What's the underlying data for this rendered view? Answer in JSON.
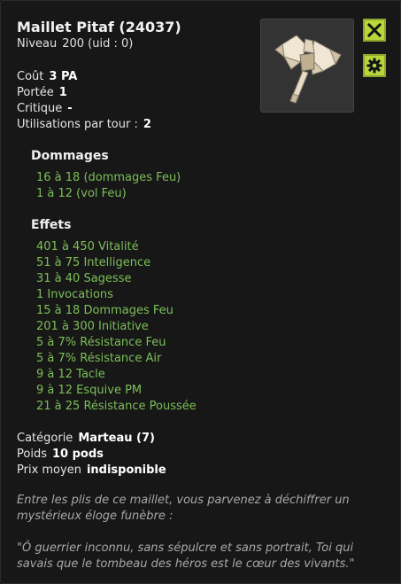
{
  "item": {
    "title": "Maillet Pitaf (24037)",
    "level_label": "Niveau",
    "level_value": "200 (uid : 0)"
  },
  "stats": [
    {
      "label": "Coût",
      "value": "3 PA"
    },
    {
      "label": "Portée",
      "value": "1"
    },
    {
      "label": "Critique",
      "value": "-"
    },
    {
      "label": "Utilisations par tour :",
      "value": "2"
    }
  ],
  "damage": {
    "title": "Dommages",
    "lines": [
      "16 à 18 (dommages Feu)",
      "1 à 12 (vol Feu)"
    ]
  },
  "effects": {
    "title": "Effets",
    "lines": [
      "401 à 450 Vitalité",
      "51 à 75 Intelligence",
      "31 à 40 Sagesse",
      "1 Invocations",
      "15 à 18 Dommages Feu",
      "201 à 300 Initiative",
      "5 à 7% Résistance Feu",
      "5 à 7% Résistance Air",
      "9 à 12 Tacle",
      "9 à 12 Esquive PM",
      "21 à 25 Résistance Poussée"
    ]
  },
  "meta": [
    {
      "label": "Catégorie",
      "value": "Marteau (7)"
    },
    {
      "label": "Poids",
      "value": "10 pods"
    },
    {
      "label": "Prix moyen",
      "value": "indisponible"
    }
  ],
  "description": {
    "intro": "Entre les plis de ce maillet, vous parvenez à déchiffrer un mystérieux éloge funèbre :",
    "quote": "\"Ô guerrier inconnu, sans sépulcre et sans portrait, Toi qui savais que le tombeau des héros est le cœur des vivants.\""
  },
  "icons": {
    "close": "close-icon",
    "settings": "gear-icon",
    "item_image": "hammer-axe-icon"
  },
  "colors": {
    "accent": "#b9d63b",
    "effect_green": "#7cbf57"
  }
}
